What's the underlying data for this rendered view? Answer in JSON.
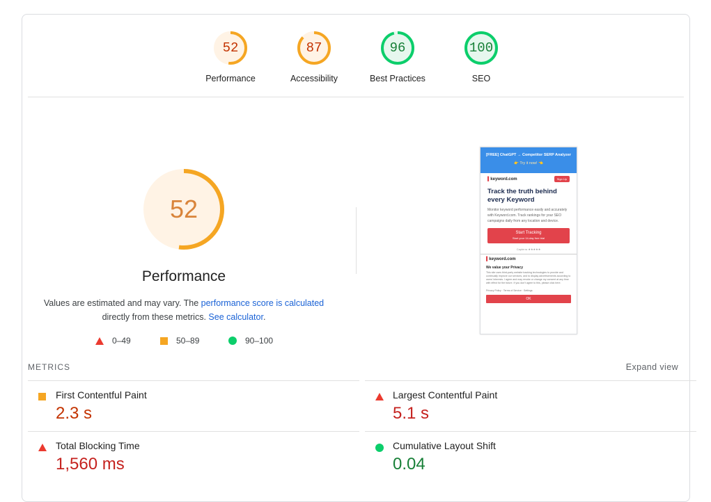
{
  "categories": [
    {
      "score": "52",
      "label": "Performance",
      "value": 52,
      "color": "#f5a623",
      "bg": "#fff3e5",
      "text_color": "#c33300"
    },
    {
      "score": "87",
      "label": "Accessibility",
      "value": 87,
      "color": "#f5a623",
      "bg": "#fff3e5",
      "text_color": "#c33300"
    },
    {
      "score": "96",
      "label": "Best Practices",
      "value": 96,
      "color": "#0cce6b",
      "bg": "#e6f7ee",
      "text_color": "#188038"
    },
    {
      "score": "100",
      "label": "SEO",
      "value": 100,
      "color": "#0cce6b",
      "bg": "#e6f7ee",
      "text_color": "#188038"
    }
  ],
  "performance": {
    "score": "52",
    "value": 52,
    "title": "Performance",
    "desc_prefix": "Values are estimated and may vary. The ",
    "desc_link1": "performance score is calculated",
    "desc_middle": "directly from these metrics. ",
    "desc_link2": "See calculator",
    "desc_suffix": "."
  },
  "legend": {
    "fail": "0–49",
    "average": "50–89",
    "pass": "90–100"
  },
  "screenshot": {
    "banner_title": "[FREE] ChatGPT → Competitor SERP Analyzer",
    "banner_sub": "👉 Try it now! 👈",
    "logo": "keyword.com",
    "signup": "Sign Up",
    "headline": "Track the truth behind every Keyword",
    "paragraph": "Monitor keyword performance easily and accurately with Keyword.com. Track rankings for your SEO campaigns daily from any location and device.",
    "cta": "Start Tracking",
    "cta_sub": "Start your 14-day free trial",
    "badge": "Capterra ★★★★★",
    "modal_title": "We value your Privacy",
    "modal_text": "This site uses third-party website tracking technologies to provide and continually improve our services, and to display advertisements according to users' interests. I agree and may revoke or change my consent at any time with effect for the future. If you don't agree to this, please click here.",
    "modal_links": "Privacy Policy · Terms of Service · Settings",
    "ok": "OK"
  },
  "metrics_section": {
    "label": "METRICS",
    "expand": "Expand view"
  },
  "metrics": [
    {
      "name": "First Contentful Paint",
      "value": "2.3 s",
      "status": "average"
    },
    {
      "name": "Largest Contentful Paint",
      "value": "5.1 s",
      "status": "fail"
    },
    {
      "name": "Total Blocking Time",
      "value": "1,560 ms",
      "status": "fail"
    },
    {
      "name": "Cumulative Layout Shift",
      "value": "0.04",
      "status": "pass"
    }
  ]
}
